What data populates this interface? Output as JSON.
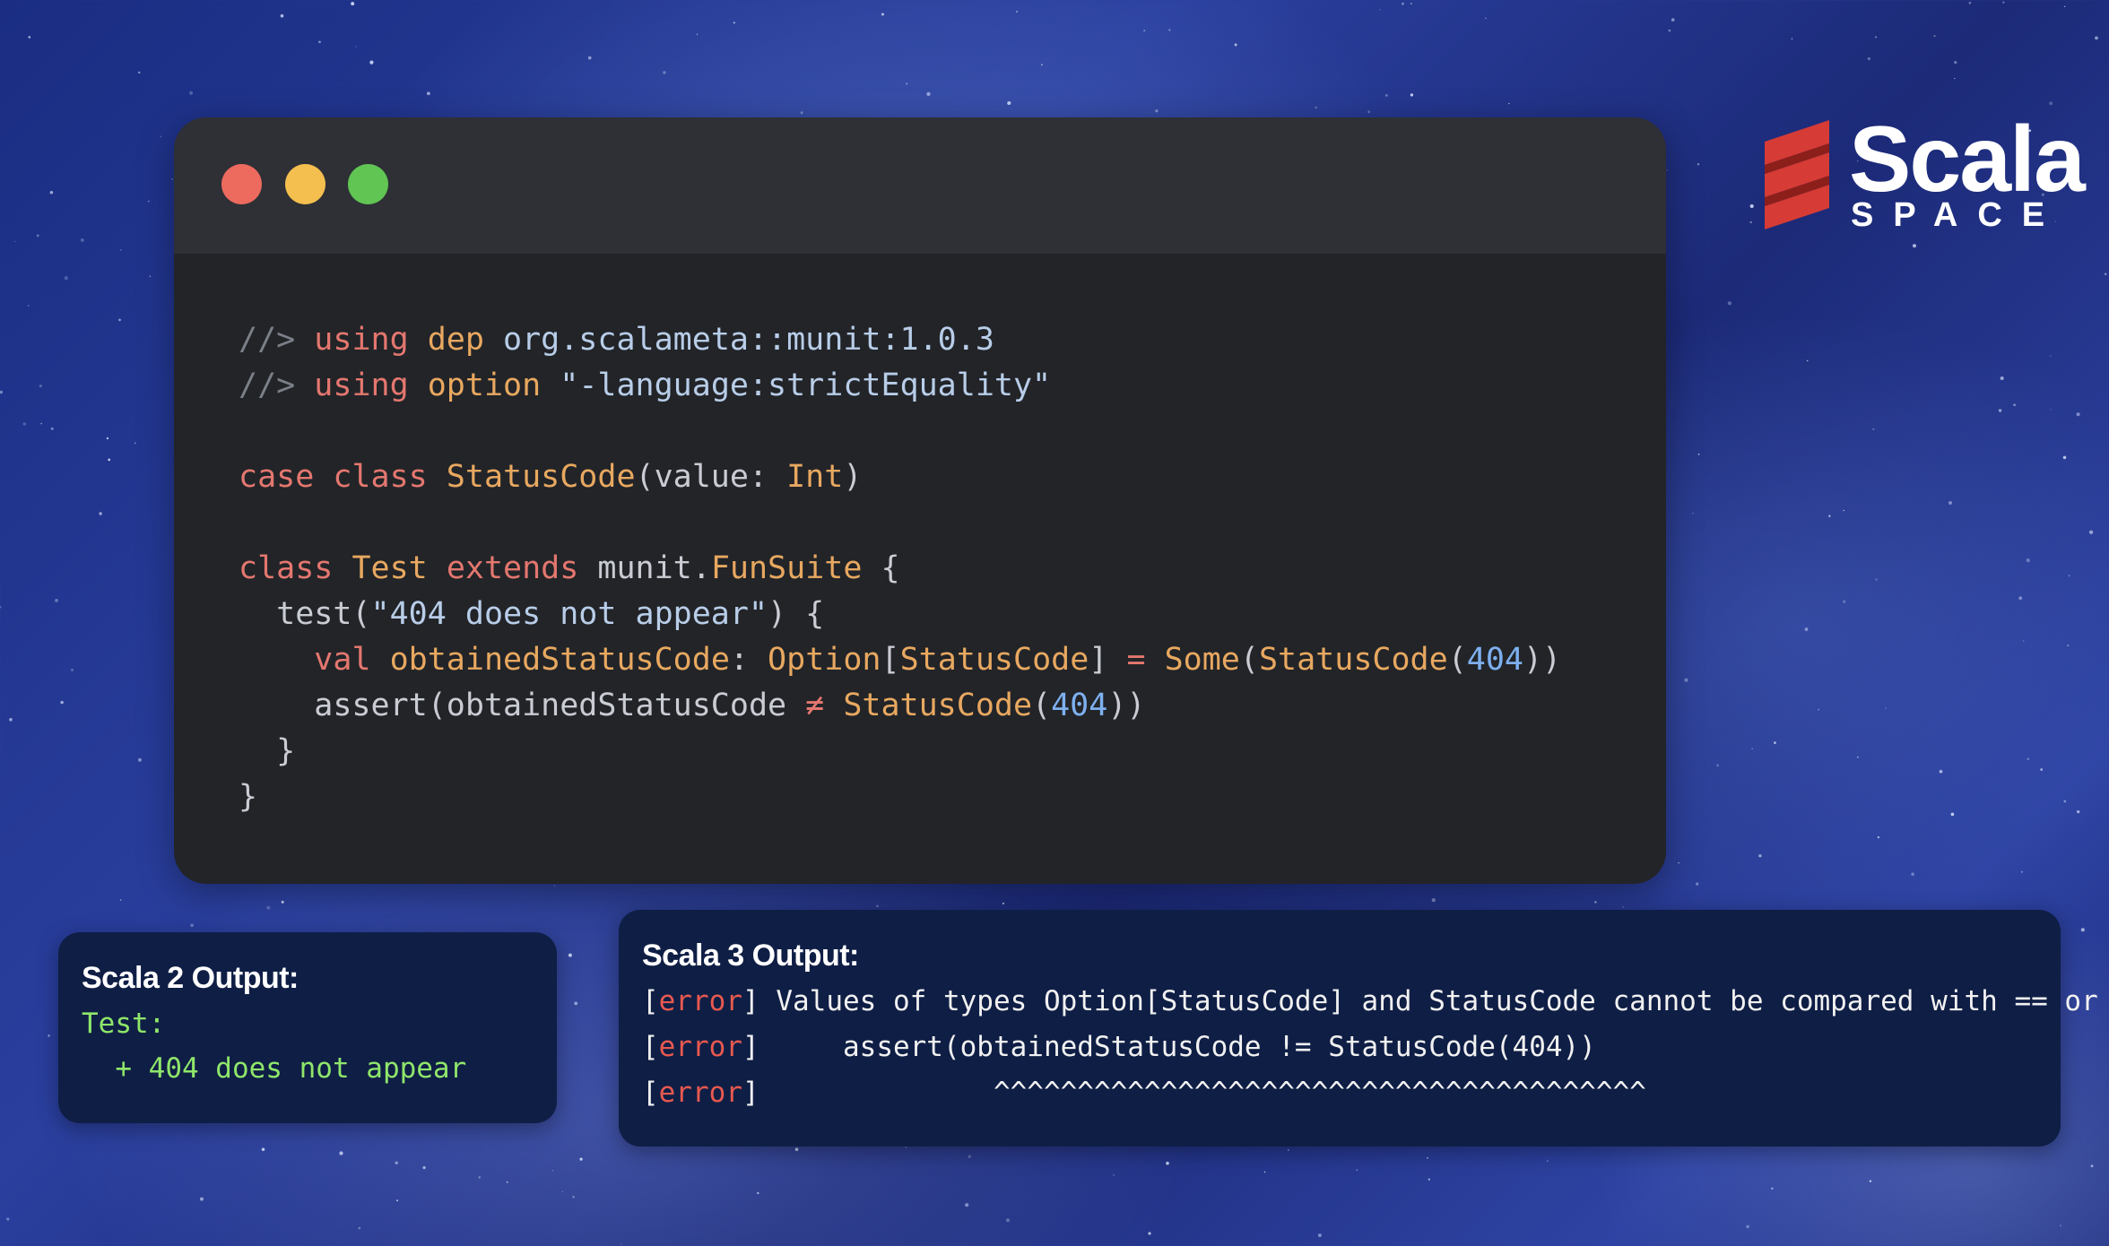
{
  "window": {
    "buttons": [
      "close",
      "minimize",
      "zoom"
    ],
    "code_lines": [
      [
        {
          "t": "//> ",
          "c": "cm"
        },
        {
          "t": "using",
          "c": "kw"
        },
        {
          "t": " ",
          "c": "pl"
        },
        {
          "t": "dep",
          "c": "ty"
        },
        {
          "t": " org.scalameta::munit:1.0.3",
          "c": "st"
        }
      ],
      [
        {
          "t": "//> ",
          "c": "cm"
        },
        {
          "t": "using",
          "c": "kw"
        },
        {
          "t": " ",
          "c": "pl"
        },
        {
          "t": "option",
          "c": "ty"
        },
        {
          "t": " \"-language:strictEquality\"",
          "c": "st"
        }
      ],
      [],
      [
        {
          "t": "case class ",
          "c": "kw"
        },
        {
          "t": "StatusCode",
          "c": "ty"
        },
        {
          "t": "(value: ",
          "c": "pl"
        },
        {
          "t": "Int",
          "c": "ty"
        },
        {
          "t": ")",
          "c": "pl"
        }
      ],
      [],
      [
        {
          "t": "class ",
          "c": "kw"
        },
        {
          "t": "Test",
          "c": "ty"
        },
        {
          "t": " ",
          "c": "pl"
        },
        {
          "t": "extends",
          "c": "kw"
        },
        {
          "t": " munit.",
          "c": "pl"
        },
        {
          "t": "FunSuite",
          "c": "ty"
        },
        {
          "t": " {",
          "c": "pl"
        }
      ],
      [
        {
          "t": "  test(",
          "c": "pl"
        },
        {
          "t": "\"404 does not appear\"",
          "c": "st"
        },
        {
          "t": ") {",
          "c": "pl"
        }
      ],
      [
        {
          "t": "    ",
          "c": "pl"
        },
        {
          "t": "val",
          "c": "kw"
        },
        {
          "t": " ",
          "c": "pl"
        },
        {
          "t": "obtainedStatusCode",
          "c": "ty"
        },
        {
          "t": ": ",
          "c": "pl"
        },
        {
          "t": "Option",
          "c": "ty"
        },
        {
          "t": "[",
          "c": "pl"
        },
        {
          "t": "StatusCode",
          "c": "ty"
        },
        {
          "t": "] ",
          "c": "pl"
        },
        {
          "t": "=",
          "c": "kw"
        },
        {
          "t": " ",
          "c": "pl"
        },
        {
          "t": "Some",
          "c": "ty"
        },
        {
          "t": "(",
          "c": "pl"
        },
        {
          "t": "StatusCode",
          "c": "ty"
        },
        {
          "t": "(",
          "c": "pl"
        },
        {
          "t": "404",
          "c": "nu"
        },
        {
          "t": "))",
          "c": "pl"
        }
      ],
      [
        {
          "t": "    assert(obtainedStatusCode ",
          "c": "pl"
        },
        {
          "t": "≠",
          "c": "kw"
        },
        {
          "t": " ",
          "c": "pl"
        },
        {
          "t": "StatusCode",
          "c": "ty"
        },
        {
          "t": "(",
          "c": "pl"
        },
        {
          "t": "404",
          "c": "nu"
        },
        {
          "t": "))",
          "c": "pl"
        }
      ],
      [
        {
          "t": "  }",
          "c": "pl"
        }
      ],
      [
        {
          "t": "}",
          "c": "pl"
        }
      ]
    ]
  },
  "logo": {
    "word": "Scala",
    "sub": "SPACE",
    "brand_color": "#d63b35"
  },
  "scala2": {
    "title": "Scala 2 Output:",
    "line1": "Test:",
    "line2": "  + 404 does not appear"
  },
  "scala3": {
    "title": "Scala 3 Output:",
    "lines": [
      {
        "tag": "error",
        "text": " Values of types Option[StatusCode] and StatusCode cannot be compared with == or !="
      },
      {
        "tag": "error",
        "text": "     assert(obtainedStatusCode != StatusCode(404))"
      },
      {
        "tag": "error",
        "text": "              ^^^^^^^^^^^^^^^^^^^^^^^^^^^^^^^^^^^^^^^"
      }
    ]
  },
  "colors": {
    "keyword": "#e4776f",
    "type": "#e8a860",
    "string": "#b8cde8",
    "number": "#7eb0ef",
    "comment": "#7b7f88",
    "error": "#e8594f",
    "success": "#8fe66a",
    "panel_bg": "#0f1e45",
    "editor_bg": "#222428"
  }
}
